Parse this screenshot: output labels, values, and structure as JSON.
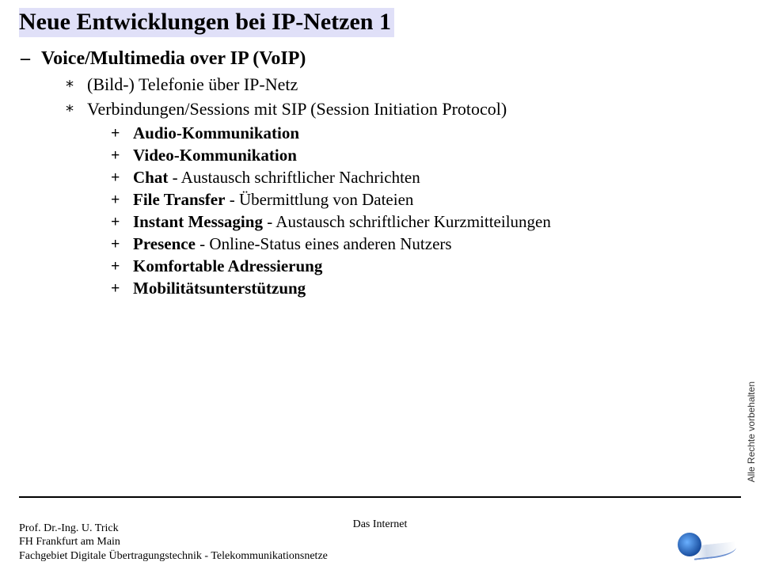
{
  "title": "Neue Entwicklungen bei IP-Netzen  1",
  "lvl1": "Voice/Multimedia over IP (VoIP)",
  "lvl2": [
    "(Bild-) Telefonie über IP-Netz",
    "Verbindungen/Sessions mit SIP (Session Initiation Protocol)"
  ],
  "lvl3": [
    {
      "bold": "Audio-Kommunikation",
      "rest": ""
    },
    {
      "bold": "Video-Kommunikation",
      "rest": ""
    },
    {
      "bold": "Chat",
      "rest": " - Austausch schriftlicher Nachrichten"
    },
    {
      "bold": "File Transfer",
      "rest": " - Übermittlung von Dateien"
    },
    {
      "bold": "Instant Messaging",
      "rest": " - Austausch schriftlicher Kurzmitteilungen"
    },
    {
      "bold": "Presence",
      "rest": " - Online-Status eines anderen Nutzers"
    },
    {
      "bold": "Komfortable Adressierung",
      "rest": ""
    },
    {
      "bold": "Mobilitätsunterstützung",
      "rest": ""
    }
  ],
  "footer": {
    "line1": "Prof. Dr.-Ing. U. Trick",
    "line2": "FH Frankfurt am Main",
    "line3": "Fachgebiet Digitale Übertragungstechnik - Telekommunikationsnetze",
    "center": "Das Internet"
  },
  "side": "Alle Rechte vorbehalten"
}
